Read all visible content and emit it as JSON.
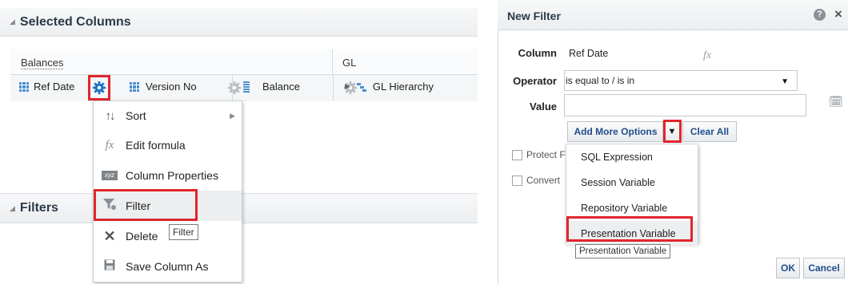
{
  "selected_columns": {
    "title": "Selected Columns",
    "groups": [
      {
        "label": "Balances"
      },
      {
        "label": "GL"
      }
    ],
    "columns": [
      {
        "label": "Ref Date"
      },
      {
        "label": "Version No"
      },
      {
        "label": "Balance"
      },
      {
        "label": "GL Hierarchy"
      }
    ]
  },
  "context_menu": {
    "items": [
      {
        "label": "Sort",
        "icon": "sort-icon"
      },
      {
        "label": "Edit formula",
        "icon": "fx-icon"
      },
      {
        "label": "Column Properties",
        "icon": "xyz-icon"
      },
      {
        "label": "Filter",
        "icon": "filter-icon"
      },
      {
        "label": "Delete",
        "icon": "delete-icon"
      },
      {
        "label": "Save Column As",
        "icon": "save-icon"
      }
    ],
    "tooltip": "Filter"
  },
  "filters": {
    "title": "Filters"
  },
  "new_filter": {
    "title": "New Filter",
    "column_label": "Column",
    "column_value": "Ref Date",
    "fx_label": "fx",
    "operator_label": "Operator",
    "operator_value": "is equal to / is in",
    "value_label": "Value",
    "value_value": "",
    "add_more_options": "Add More Options",
    "clear_all": "Clear All",
    "protect_label": "Protect F",
    "convert_label": "Convert",
    "options": [
      "SQL Expression",
      "Session Variable",
      "Repository Variable",
      "Presentation Variable"
    ],
    "options_tooltip": "Presentation Variable",
    "ok": "OK",
    "cancel": "Cancel"
  },
  "colors": {
    "highlight": "#e0262d",
    "gear_active": "#1a73c9",
    "link": "#1f4e8c"
  }
}
